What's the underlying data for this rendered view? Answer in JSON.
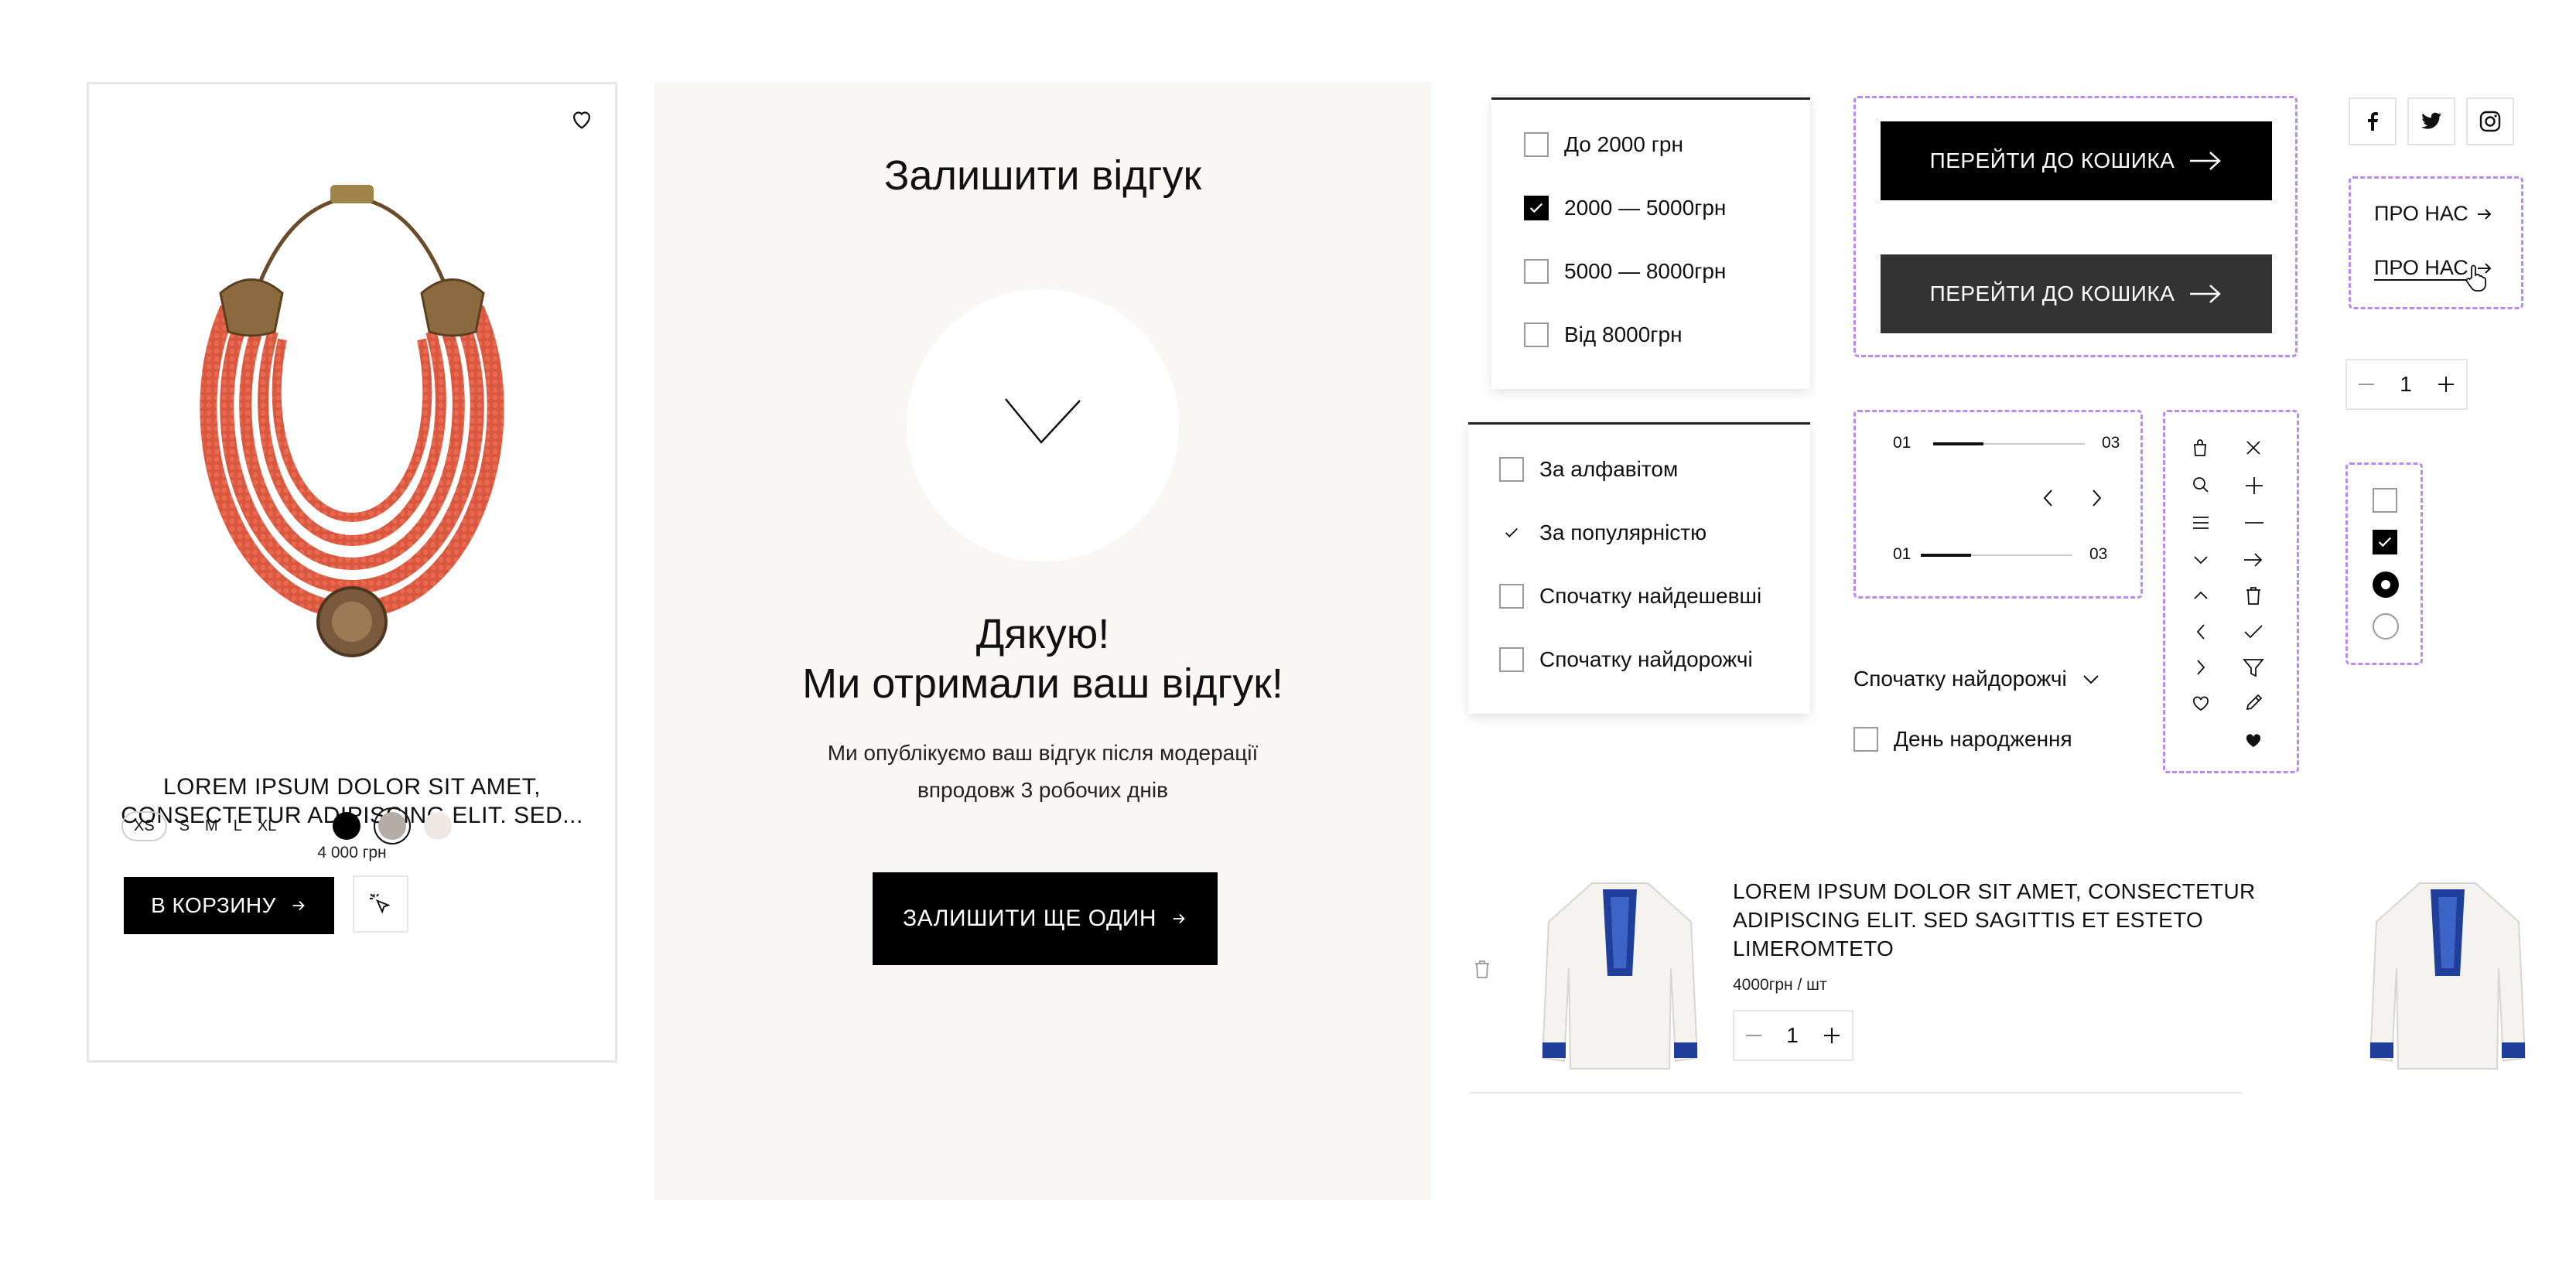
{
  "product_card": {
    "title": "LOREM IPSUM DOLOR SIT AMET, CONSECTETUR ADIPISCING ELIT. SED...",
    "price": "4 000 грн",
    "sizes": [
      "XS",
      "S",
      "M",
      "L",
      "XL"
    ],
    "selected_size": "XS",
    "colors": [
      "#000000",
      "#b5aca8",
      "#efe7e4"
    ],
    "selected_color_index": 1,
    "cart_button": "В КОРЗИНУ"
  },
  "review": {
    "heading": "Залишити відгук",
    "thanks_line1": "Дякую!",
    "thanks_line2": "Ми отримали ваш відгук!",
    "subtext_line1": "Ми опублікуємо ваш відгук після модерації",
    "subtext_line2": "впродовж 3 робочих днів",
    "again_button": "ЗАЛИШИТИ ЩЕ ОДИН"
  },
  "price_filter": {
    "options": [
      {
        "label": "До 2000 грн",
        "checked": false
      },
      {
        "label": "2000 — 5000грн",
        "checked": true
      },
      {
        "label": "5000 — 8000грн",
        "checked": false
      },
      {
        "label": "Від 8000грн",
        "checked": false
      }
    ]
  },
  "sort_filter": {
    "options": [
      {
        "label": "За алфавітом",
        "checked": false
      },
      {
        "label": "За популярністю",
        "checked": true
      },
      {
        "label": "Спочатку найдешевші",
        "checked": false
      },
      {
        "label": "Спочатку найдорожчі",
        "checked": false
      }
    ]
  },
  "go_to_cart": {
    "button_default": "ПЕРЕЙТИ ДО КОШИКА",
    "button_hover": "ПЕРЕЙТИ ДО КОШИКА"
  },
  "sliders": [
    {
      "start": "01",
      "end": "03",
      "progress": 0.33
    },
    {
      "start": "01",
      "end": "03",
      "progress": 0.33
    }
  ],
  "sort_dropdown": {
    "selected": "Спочатку найдорожчі"
  },
  "birthday_checkbox": {
    "label": "День народження",
    "checked": false
  },
  "icon_set": [
    "bag-icon",
    "close-icon",
    "search-icon",
    "plus-icon",
    "menu-icon",
    "minus-icon",
    "chevron-down-icon",
    "arrow-right-icon",
    "chevron-up-icon",
    "trash-icon",
    "chevron-left-icon",
    "check-icon",
    "chevron-right-icon",
    "filter-icon",
    "heart-outline-icon",
    "pencil-icon",
    "heart-filled-icon"
  ],
  "social": [
    "facebook-icon",
    "twitter-icon",
    "instagram-icon"
  ],
  "about_links": {
    "default": "ПРО НАС",
    "hover": "ПРО НАС"
  },
  "quantity_stepper": {
    "value": "1"
  },
  "cart_item": {
    "title": "LOREM IPSUM DOLOR SIT AMET, CONSECTETUR ADIPISCING ELIT. SED SAGITTIS ET ESTETO LIMEROMTETO",
    "price": "4000грн / шт",
    "quantity": "1"
  }
}
